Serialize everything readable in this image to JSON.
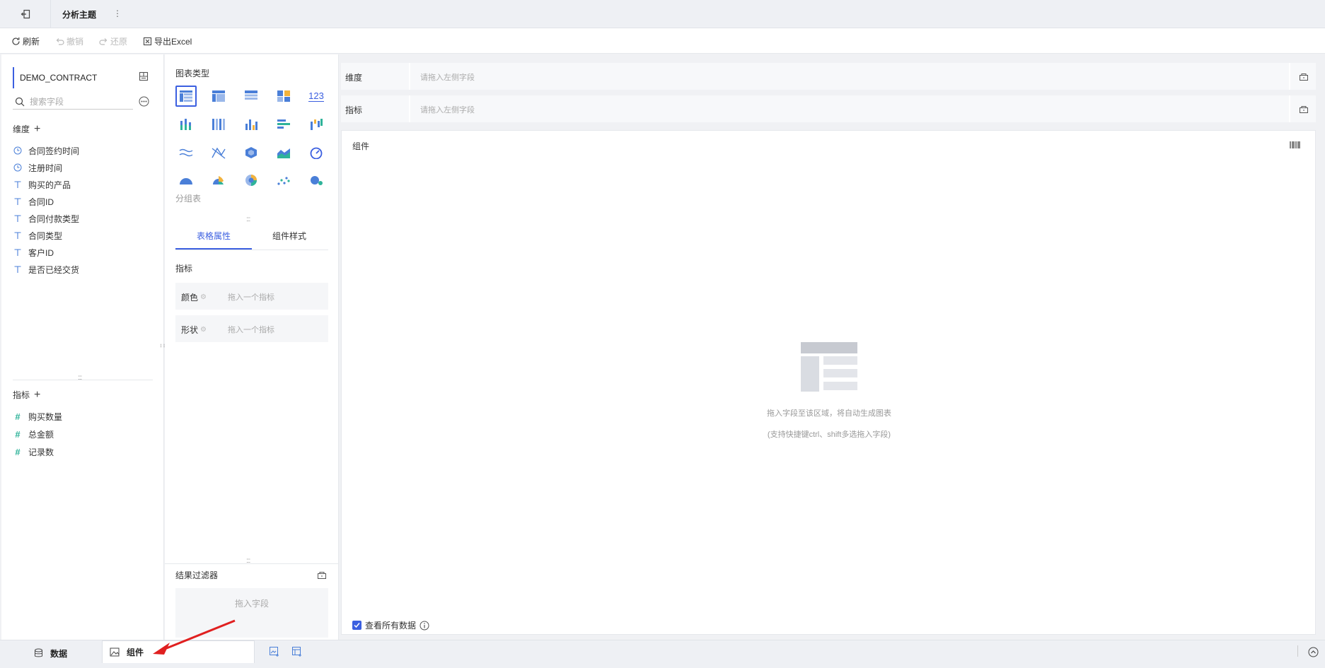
{
  "header": {
    "title": "分析主题",
    "more_icon": "⋮"
  },
  "toolbar": {
    "refresh": "刷新",
    "undo": "撤销",
    "redo": "还原",
    "export": "导出Excel"
  },
  "datasource": {
    "name": "DEMO_CONTRACT",
    "search_placeholder": "搜索字段"
  },
  "dimensions": {
    "title": "维度",
    "items": [
      {
        "label": "合同签约时间",
        "type": "time"
      },
      {
        "label": "注册时间",
        "type": "time"
      },
      {
        "label": "购买的产品",
        "type": "text"
      },
      {
        "label": "合同ID",
        "type": "text"
      },
      {
        "label": "合同付款类型",
        "type": "text"
      },
      {
        "label": "合同类型",
        "type": "text"
      },
      {
        "label": "客户ID",
        "type": "text"
      },
      {
        "label": "是否已经交货",
        "type": "text"
      }
    ]
  },
  "metrics": {
    "title": "指标",
    "items": [
      {
        "label": "购买数量"
      },
      {
        "label": "总金额"
      },
      {
        "label": "记录数"
      }
    ]
  },
  "chart_types": {
    "title": "图表类型",
    "selected_caption": "分组表",
    "number_icon_text": "123"
  },
  "mid_tabs": {
    "table_props": "表格属性",
    "component_style": "组件样式"
  },
  "metric_section": {
    "title": "指标",
    "color_label": "颜色",
    "shape_label": "形状",
    "drop_placeholder": "拖入一个指标"
  },
  "result_filter": {
    "title": "结果过滤器",
    "placeholder": "拖入字段"
  },
  "shelves": {
    "dimension_label": "维度",
    "metric_label": "指标",
    "placeholder": "请拖入左侧字段"
  },
  "canvas": {
    "title": "组件",
    "empty_tip": "拖入字段至该区域，将自动生成图表",
    "empty_hint": "(支持快捷键ctrl、shift多选拖入字段)",
    "view_all_label": "查看所有数据",
    "view_all_checked": true
  },
  "bottom_tabs": {
    "data": "数据",
    "components": "组件",
    "active": "组件"
  },
  "colors": {
    "accent": "#3b5fe0",
    "arrow": "#e02020"
  }
}
